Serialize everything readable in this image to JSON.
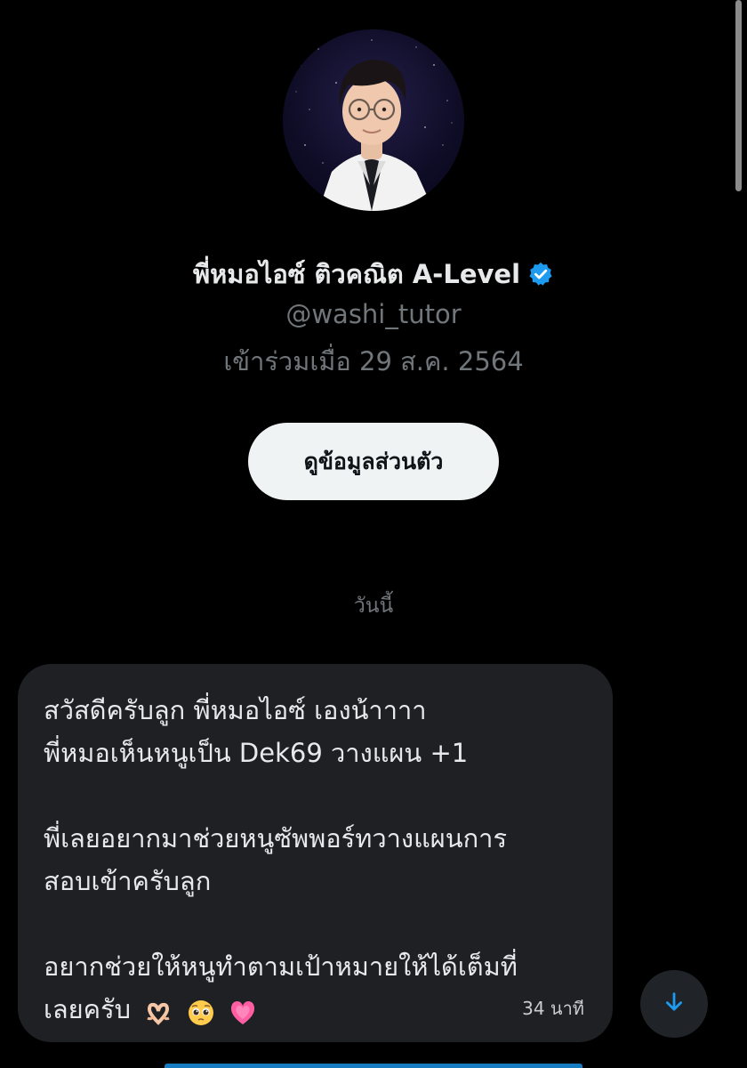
{
  "profile": {
    "name": "พี่หมอไอซ์ ติวคณิต A-Level",
    "handle": "@washi_tutor",
    "joined": "เข้าร่วมเมื่อ 29 ส.ค. 2564",
    "verified": true,
    "view_profile_label": "ดูข้อมูลส่วนตัว"
  },
  "conversation": {
    "date_separator": "วันนี้",
    "message": {
      "lines": [
        "สวัสดีครับลูก พี่หมอไอซ์ เองน้าาาา",
        "พี่หมอเห็นหนูเป็น Dek69 วางแผน +1",
        "",
        "พี่เลยอยากมาช่วยหนูซัพพอร์ทวางแผนการ",
        "สอบเข้าครับลูก",
        "",
        "อยากช่วยให้หนูทำตามเป้าหมายให้ได้เต็มที่",
        "เลยครับ"
      ],
      "emojis": [
        "heart-hands-icon",
        "pleading-face-icon",
        "growing-heart-icon"
      ],
      "time": "34 นาที"
    }
  },
  "colors": {
    "background": "#000000",
    "bubble": "#1e2023",
    "accent": "#1d9bf0",
    "muted_text": "#71767b"
  }
}
